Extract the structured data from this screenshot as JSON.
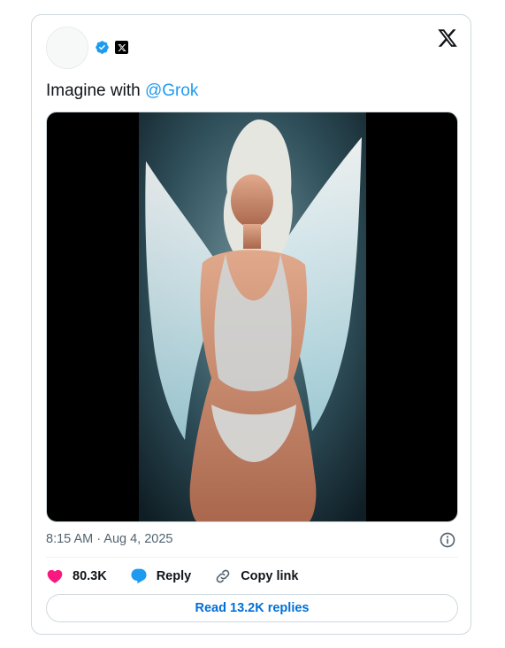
{
  "tweet": {
    "text_prefix": "Imagine with ",
    "mention": "@Grok",
    "timestamp": "8:15 AM · Aug 4, 2025"
  },
  "icons": {
    "verified": "verified-badge-icon",
    "affiliate": "x-affiliate-badge-icon",
    "brand": "x-logo-icon",
    "info": "info-icon",
    "like": "heart-icon",
    "reply": "speech-bubble-icon",
    "copy": "link-icon"
  },
  "actions": {
    "likes": "80.3K",
    "reply_label": "Reply",
    "copy_label": "Copy link"
  },
  "read_replies": "Read 13.2K replies",
  "colors": {
    "accent": "#1d9bf0",
    "link": "#006fd6",
    "like": "#f91880",
    "muted": "#536471",
    "border": "#cfd9de"
  }
}
